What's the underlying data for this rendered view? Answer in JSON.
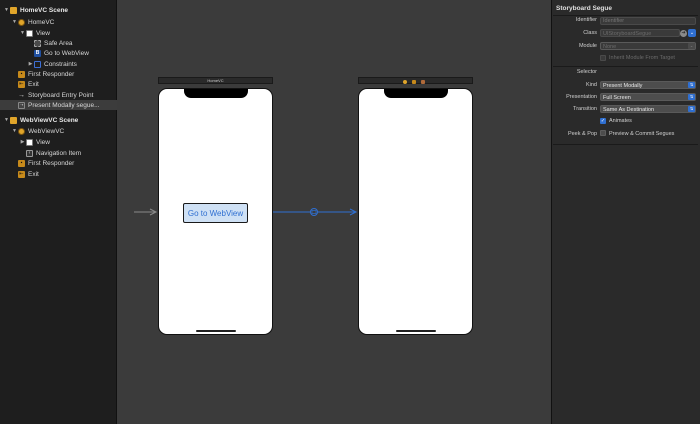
{
  "outline": {
    "items": [
      {
        "label": "HomeVC Scene",
        "icon": "scene-icon",
        "depth": 0,
        "arrow": "open",
        "scene": true
      },
      {
        "label": "HomeVC",
        "icon": "viewcontroller-icon",
        "depth": 1,
        "arrow": "open"
      },
      {
        "label": "View",
        "icon": "view-icon",
        "depth": 2,
        "arrow": "open"
      },
      {
        "label": "Safe Area",
        "icon": "safe-area-icon",
        "depth": 3,
        "arrow": "none"
      },
      {
        "label": "Go to WebView",
        "icon": "button-icon",
        "depth": 3,
        "arrow": "none"
      },
      {
        "label": "Constraints",
        "icon": "constraints-icon",
        "depth": 3,
        "arrow": "closed"
      },
      {
        "label": "First Responder",
        "icon": "first-responder-icon",
        "depth": 1,
        "arrow": "none"
      },
      {
        "label": "Exit",
        "icon": "exit-icon",
        "depth": 1,
        "arrow": "none"
      },
      {
        "label": "Storyboard Entry Point",
        "icon": "entry-point-icon",
        "depth": 1,
        "arrow": "none"
      },
      {
        "label": "Present Modally segue...",
        "icon": "segue-icon",
        "depth": 1,
        "arrow": "none",
        "selected": true
      },
      {
        "label": "WebViewVC Scene",
        "icon": "scene-icon",
        "depth": 0,
        "arrow": "open",
        "scene": true
      },
      {
        "label": "WebViewVC",
        "icon": "viewcontroller-icon",
        "depth": 1,
        "arrow": "open"
      },
      {
        "label": "View",
        "icon": "view-icon",
        "depth": 2,
        "arrow": "closed"
      },
      {
        "label": "Navigation Item",
        "icon": "navigation-item-icon",
        "depth": 2,
        "arrow": "none"
      },
      {
        "label": "First Responder",
        "icon": "first-responder-icon",
        "depth": 1,
        "arrow": "none"
      },
      {
        "label": "Exit",
        "icon": "exit-icon",
        "depth": 1,
        "arrow": "none"
      }
    ]
  },
  "canvas": {
    "homevc_title": "HomeVC",
    "button_label": "Go to WebView",
    "scene_dot_colors": [
      "#e0a52a",
      "#c78a1b",
      "#b06a3a"
    ]
  },
  "inspector": {
    "title": "Storyboard Segue",
    "identifier": {
      "label": "Identifier",
      "placeholder": "Identifier"
    },
    "class": {
      "label": "Class",
      "placeholder": "UIStoryboardSegue"
    },
    "module": {
      "label": "Module",
      "placeholder": "None"
    },
    "inherit_label": "Inherit Module From Target",
    "selector_label": "Selector",
    "kind": {
      "label": "Kind",
      "value": "Present Modally"
    },
    "presentation": {
      "label": "Presentation",
      "value": "Full Screen"
    },
    "transition": {
      "label": "Transition",
      "value": "Same As Destination"
    },
    "animates_label": "Animates",
    "peek_pop": {
      "label": "Peek & Pop",
      "value": "Preview & Commit Segues"
    }
  },
  "colors": {
    "accent": "#2f6fd1",
    "segue_line": "#2f6fd1"
  }
}
